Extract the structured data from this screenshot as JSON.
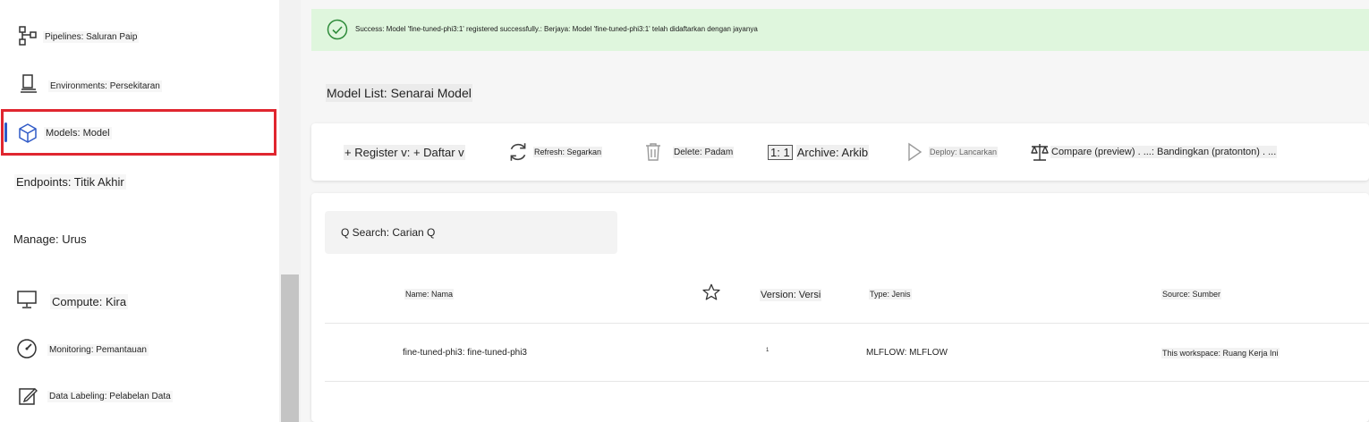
{
  "sidebar": {
    "items": [
      {
        "label": "Pipelines: Saluran Paip",
        "icon": "pipeline-icon"
      },
      {
        "label": "Environments: Persekitaran",
        "icon": "environment-icon"
      },
      {
        "label": "Models: Model",
        "icon": "model-cube-icon"
      },
      {
        "label": "Endpoints: Titik Akhir",
        "icon": ""
      },
      {
        "label": "Compute: Kira",
        "icon": "compute-monitor-icon"
      },
      {
        "label": "Monitoring: Pemantauan",
        "icon": "gauge-icon"
      },
      {
        "label": "Data Labeling: Pelabelan Data",
        "icon": "edit-box-icon"
      }
    ],
    "manage_heading": "Manage: Urus"
  },
  "banner": {
    "message": "Success: Model 'fine-tuned-phi3:1' registered successfully.: Berjaya: Model 'fine-tuned-phi3:1' telah didaftarkan dengan jayanya",
    "color": "#dff6dd"
  },
  "page_title": "Model List: Senarai Model",
  "toolbar": {
    "register": "+ Register v: + Daftar v",
    "refresh": "Refresh: Segarkan",
    "delete": "Delete: Padam",
    "archive_prefix": "1: 1",
    "archive": "Archive: Arkib",
    "deploy": "Deploy: Lancarkan",
    "compare": "Compare (preview) . ...: Bandingkan (pratonton) . ..."
  },
  "search": {
    "label": "Q Search: Carian Q"
  },
  "table": {
    "columns": {
      "name": "Name: Nama",
      "version": "Version: Versi",
      "type": "Type: Jenis",
      "source": "Source: Sumber"
    },
    "rows": [
      {
        "name": "fine-tuned-phi3: fine-tuned-phi3",
        "version": "1",
        "type": "MLFLOW: MLFLOW",
        "source": "This workspace: Ruang Kerja Ini"
      }
    ]
  },
  "colors": {
    "highlight": "#e0262f",
    "accent": "#2f5ac7",
    "success_icon": "#2e8b3a"
  }
}
